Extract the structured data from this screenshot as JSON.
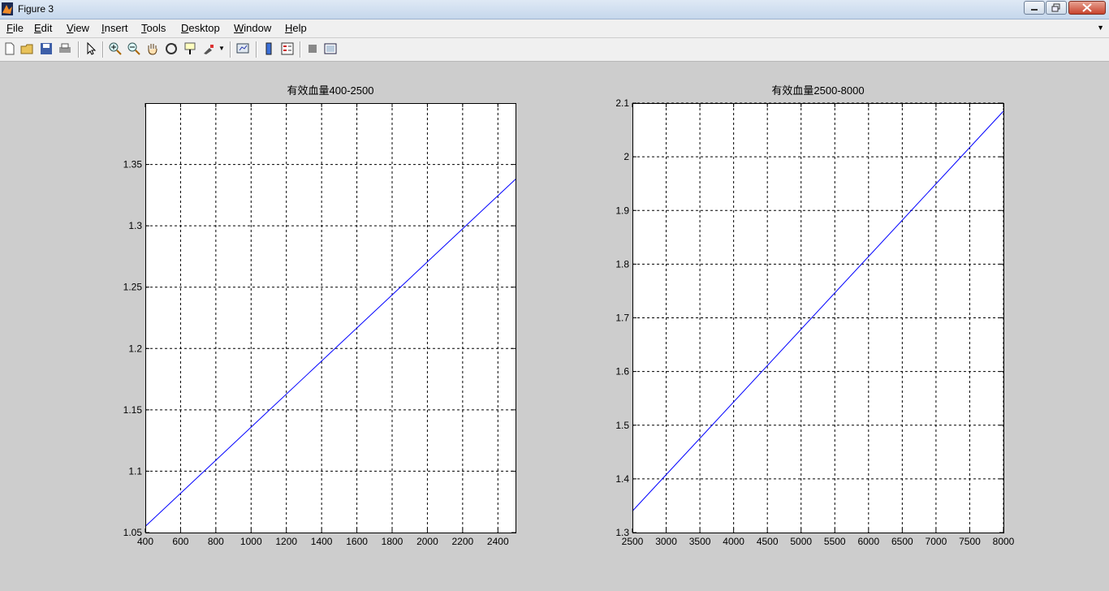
{
  "window": {
    "title": "Figure 3"
  },
  "menu": [
    "File",
    "Edit",
    "View",
    "Insert",
    "Tools",
    "Desktop",
    "Window",
    "Help"
  ],
  "toolbar": [
    "new-figure-icon",
    "open-file-icon",
    "save-icon",
    "print-icon",
    "pointer-icon",
    "zoom-in-icon",
    "zoom-out-icon",
    "pan-hand-icon",
    "rotate-3d-icon",
    "data-cursor-icon",
    "brush-icon",
    "link-plot-icon",
    "colorbar-icon",
    "legend-icon",
    "hide-plot-tools-icon",
    "show-plot-tools-icon"
  ],
  "chart_data": [
    {
      "type": "line",
      "title": "有效血量400-2500",
      "xlabel": "",
      "ylabel": "",
      "xlim": [
        400,
        2500
      ],
      "ylim": [
        1.05,
        1.4
      ],
      "xticks": [
        400,
        600,
        800,
        1000,
        1200,
        1400,
        1600,
        1800,
        2000,
        2200,
        2400
      ],
      "yticks": [
        1.05,
        1.1,
        1.15,
        1.2,
        1.25,
        1.3,
        1.35
      ],
      "grid": true,
      "series": [
        {
          "color": "#0000ff",
          "x": [
            400,
            2500
          ],
          "y": [
            1.055,
            1.338
          ]
        }
      ]
    },
    {
      "type": "line",
      "title": "有效血量2500-8000",
      "xlabel": "",
      "ylabel": "",
      "xlim": [
        2500,
        8000
      ],
      "ylim": [
        1.3,
        2.1
      ],
      "xticks": [
        2500,
        3000,
        3500,
        4000,
        4500,
        5000,
        5500,
        6000,
        6500,
        7000,
        7500,
        8000
      ],
      "yticks": [
        1.3,
        1.4,
        1.5,
        1.6,
        1.7,
        1.8,
        1.9,
        2.0,
        2.1
      ],
      "grid": true,
      "series": [
        {
          "color": "#0000ff",
          "x": [
            2500,
            8000
          ],
          "y": [
            1.34,
            2.085
          ]
        }
      ]
    }
  ]
}
